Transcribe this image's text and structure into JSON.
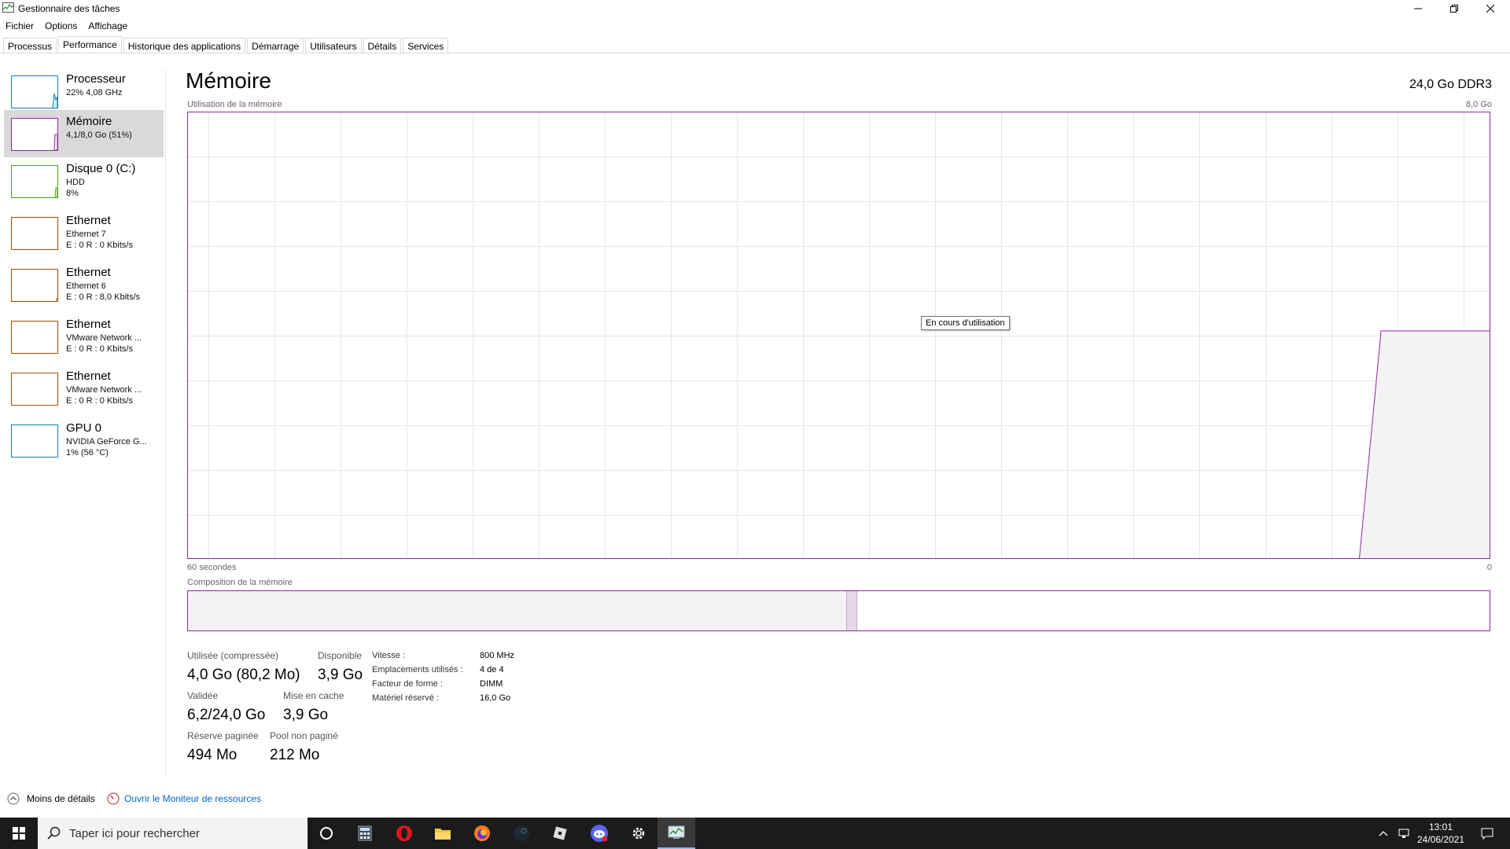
{
  "window": {
    "title": "Gestionnaire des tâches"
  },
  "menu": [
    "Fichier",
    "Options",
    "Affichage"
  ],
  "tabs": [
    "Processus",
    "Performance",
    "Historique des applications",
    "Démarrage",
    "Utilisateurs",
    "Détails",
    "Services"
  ],
  "active_tab": "Performance",
  "sidebar": [
    {
      "name": "Processeur",
      "sub1": "22% 4,08 GHz",
      "sub2": "",
      "sub3": "",
      "color": "#117dbb"
    },
    {
      "name": "Mémoire",
      "sub1": "4,1/8,0 Go (51%)",
      "sub2": "",
      "sub3": "",
      "color": "#8b2c9b"
    },
    {
      "name": "Disque 0 (C:)",
      "sub1": "HDD",
      "sub2": "8%",
      "sub3": "",
      "color": "#4da60c"
    },
    {
      "name": "Ethernet",
      "sub1": "Ethernet 7",
      "sub2": "E : 0 R : 0 Kbits/s",
      "sub3": "",
      "color": "#a74f01"
    },
    {
      "name": "Ethernet",
      "sub1": "Ethernet 6",
      "sub2": "E : 0 R : 8,0 Kbits/s",
      "sub3": "",
      "color": "#a74f01"
    },
    {
      "name": "Ethernet",
      "sub1": "VMware Network ...",
      "sub2": "E : 0 R : 0 Kbits/s",
      "sub3": "",
      "color": "#a74f01"
    },
    {
      "name": "Ethernet",
      "sub1": "VMware Network ...",
      "sub2": "E : 0 R : 0 Kbits/s",
      "sub3": "",
      "color": "#a74f01"
    },
    {
      "name": "GPU 0",
      "sub1": "NVIDIA GeForce G...",
      "sub2": "1% (56 °C)",
      "sub3": "",
      "color": "#117dbb"
    }
  ],
  "main": {
    "title": "Mémoire",
    "total": "24,0 Go DDR3",
    "graph_label": "Utilisation de la mémoire",
    "graph_max": "8,0 Go",
    "time_label": "60 secondes",
    "time_end": "0",
    "tooltip": "En cours d'utilisation",
    "composition_label": "Composition de la mémoire",
    "usage_history_fraction": [
      0,
      0,
      0,
      0,
      0,
      0,
      0,
      0,
      0,
      0,
      0,
      0,
      0,
      0,
      0,
      0,
      0,
      0,
      0,
      0,
      0,
      0,
      0,
      0,
      0,
      0,
      0,
      0,
      0,
      0,
      0,
      0,
      0,
      0,
      0,
      0,
      0,
      0,
      0,
      0,
      0,
      0,
      0,
      0,
      0,
      0,
      0,
      0,
      0,
      0,
      0,
      0,
      0,
      0,
      0,
      0.51,
      0.51,
      0.51,
      0.51,
      0.51,
      0.51
    ],
    "composition": {
      "used_fraction": 0.506,
      "modified_fraction": 0.007
    },
    "stats": {
      "used_label": "Utilisée (compressée)",
      "used_value": "4,0 Go (80,2 Mo)",
      "available_label": "Disponible",
      "available_value": "3,9 Go",
      "committed_label": "Validée",
      "committed_value": "6,2/24,0 Go",
      "cached_label": "Mise en cache",
      "cached_value": "3,9 Go",
      "paged_label": "Réserve paginée",
      "paged_value": "494 Mo",
      "nonpaged_label": "Pool non paginé",
      "nonpaged_value": "212 Mo"
    },
    "props": [
      {
        "label": "Vitesse :",
        "value": "800 MHz"
      },
      {
        "label": "Emplacements utilisés :",
        "value": "4 de 4"
      },
      {
        "label": "Facteur de forme :",
        "value": "DIMM"
      },
      {
        "label": "Matériel réservé :",
        "value": "16,0 Go"
      }
    ]
  },
  "footer": {
    "less": "Moins de détails",
    "resmon": "Ouvrir le Moniteur de ressources"
  },
  "taskbar": {
    "search_placeholder": "Taper ici pour rechercher",
    "time": "13:01",
    "date": "24/06/2021",
    "icons": [
      "cortana-icon",
      "calculator-icon",
      "opera-icon",
      "file-explorer-icon",
      "firefox-icon",
      "steam-icon",
      "roblox-icon",
      "discord-icon",
      "settings-icon",
      "task-manager-icon"
    ]
  },
  "colors": {
    "memory": "#8b2c9b",
    "graph_fill": "#f4f2f4"
  }
}
